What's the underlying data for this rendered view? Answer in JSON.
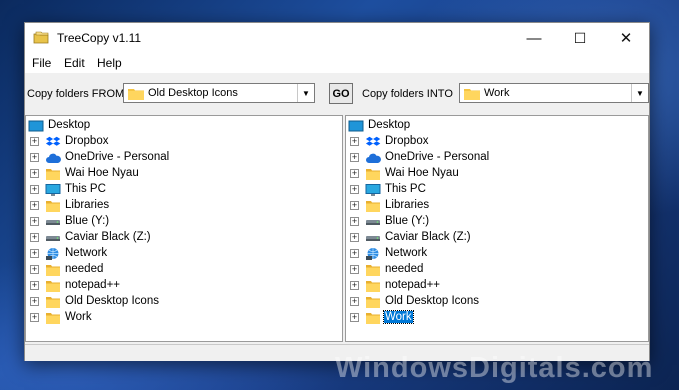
{
  "window": {
    "title": "TreeCopy v1.11",
    "minimize": "—",
    "maximize": "☐",
    "close": "✕"
  },
  "menu": [
    "File",
    "Edit",
    "Help"
  ],
  "toolbar": {
    "from_label": "Copy folders FROM",
    "from_value": "Old Desktop Icons",
    "go_label": "GO",
    "into_label": "Copy folders INTO",
    "into_value": "Work"
  },
  "tree": {
    "root": "Desktop",
    "items": [
      {
        "label": "Dropbox",
        "icon": "dropbox-icon"
      },
      {
        "label": "OneDrive - Personal",
        "icon": "cloud-icon"
      },
      {
        "label": "Wai Hoe Nyau",
        "icon": "folder-icon"
      },
      {
        "label": "This PC",
        "icon": "monitor-icon"
      },
      {
        "label": "Libraries",
        "icon": "folder-icon"
      },
      {
        "label": "Blue (Y:)",
        "icon": "drive-icon"
      },
      {
        "label": "Caviar Black (Z:)",
        "icon": "drive-icon"
      },
      {
        "label": "Network",
        "icon": "network-icon"
      },
      {
        "label": "needed",
        "icon": "folder-icon"
      },
      {
        "label": "notepad++",
        "icon": "folder-icon"
      },
      {
        "label": "Old Desktop Icons",
        "icon": "folder-icon"
      },
      {
        "label": "Work",
        "icon": "folder-icon"
      }
    ],
    "selected_right": "Work"
  },
  "watermark": "WindowsDigitals.com",
  "colors": {
    "folder": "#f5c542",
    "selection": "#0078d7",
    "accent": "#1e6fd9"
  }
}
